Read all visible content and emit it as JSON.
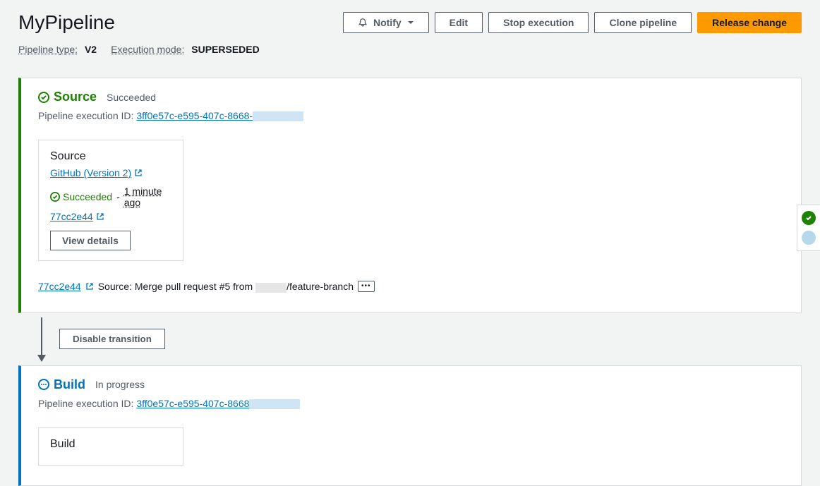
{
  "title": "MyPipeline",
  "buttons": {
    "notify": "Notify",
    "edit": "Edit",
    "stop": "Stop execution",
    "clone": "Clone pipeline",
    "release": "Release change"
  },
  "meta": {
    "pipeline_type_label": "Pipeline type:",
    "pipeline_type_value": "V2",
    "exec_mode_label": "Execution mode:",
    "exec_mode_value": "SUPERSEDED"
  },
  "stages": {
    "source": {
      "name": "Source",
      "status": "Succeeded",
      "exec_label": "Pipeline execution ID:",
      "exec_id": "3ff0e57c-e595-407c-8668-",
      "action": {
        "title": "Source",
        "provider": "GitHub (Version 2)",
        "status": "Succeeded",
        "time": "1 minute ago",
        "commit": "77cc2e44",
        "view_details": "View details"
      },
      "footer": {
        "commit": "77cc2e44",
        "msg_prefix": "Source: Merge pull request #5 from ",
        "msg_suffix": "/feature-branch"
      }
    },
    "build": {
      "name": "Build",
      "status": "In progress",
      "exec_label": "Pipeline execution ID:",
      "exec_id": "3ff0e57c-e595-407c-8668",
      "action": {
        "title": "Build"
      }
    }
  },
  "transition": {
    "disable": "Disable transition"
  }
}
